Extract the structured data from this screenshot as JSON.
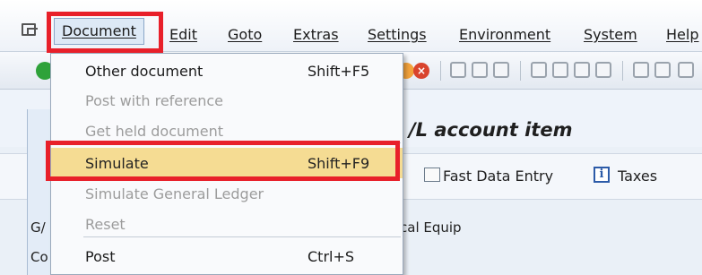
{
  "menubar": {
    "items": [
      {
        "label": "Document"
      },
      {
        "label": "Edit"
      },
      {
        "label": "Goto"
      },
      {
        "label": "Extras"
      },
      {
        "label": "Settings"
      },
      {
        "label": "Environment"
      },
      {
        "label": "System"
      },
      {
        "label": "Help"
      }
    ]
  },
  "page": {
    "title_fragment": "/L account item"
  },
  "app_toolbar": {
    "fast_data_entry": "Fast Data Entry",
    "taxes": "Taxes",
    "taxes_icon_glyph": "i"
  },
  "form": {
    "label_1": "G/",
    "label_2": "Co",
    "value_1": "cal Equip"
  },
  "dropdown": {
    "items": [
      {
        "label": "Other document",
        "shortcut": "Shift+F5",
        "state": "enabled"
      },
      {
        "label": "Post with reference",
        "shortcut": "",
        "state": "disabled"
      },
      {
        "label": "Get held document",
        "shortcut": "",
        "state": "disabled"
      },
      {
        "label": "Simulate",
        "shortcut": "Shift+F9",
        "state": "selected"
      },
      {
        "label": "Simulate General Ledger",
        "shortcut": "",
        "state": "disabled"
      },
      {
        "label": "Reset",
        "shortcut": "",
        "state": "disabled"
      },
      {
        "label": "Post",
        "shortcut": "Ctrl+S",
        "state": "enabled"
      }
    ]
  },
  "colors": {
    "highlight_box": "#e8202a",
    "selected_row": "#f5dc93",
    "disabled_text": "#9c9c9c"
  }
}
